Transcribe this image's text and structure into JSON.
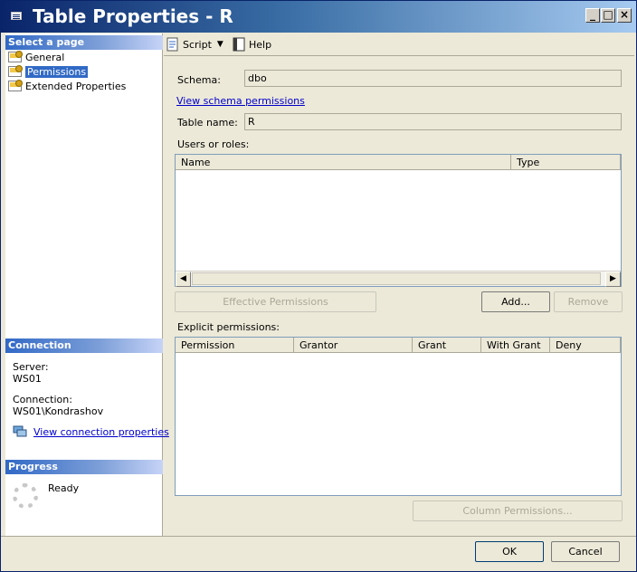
{
  "window": {
    "title": "Table Properties - R",
    "min": "_",
    "max": "□",
    "close": "×"
  },
  "left": {
    "select_page_header": "Select a page",
    "pages": [
      {
        "label": "General",
        "selected": false
      },
      {
        "label": "Permissions",
        "selected": true
      },
      {
        "label": "Extended Properties",
        "selected": false
      }
    ],
    "connection_header": "Connection",
    "server_label": "Server:",
    "server_value": "WS01",
    "connection_label": "Connection:",
    "connection_value": "WS01\\Kondrashov",
    "view_connection_link": "View connection properties",
    "progress_header": "Progress",
    "progress_status": "Ready"
  },
  "toolbar": {
    "script_label": "Script",
    "help_label": "Help"
  },
  "form": {
    "schema_label": "Schema:",
    "schema_value": "dbo",
    "view_schema_link": "View schema permissions",
    "table_name_label": "Table name:",
    "table_name_value": "R",
    "users_roles_label": "Users or roles:",
    "users_columns": [
      "Name",
      "Type"
    ],
    "effective_permissions_button": "Effective Permissions",
    "add_button": "Add...",
    "remove_button": "Remove",
    "explicit_permissions_label": "Explicit permissions:",
    "perm_columns": [
      "Permission",
      "Grantor",
      "Grant",
      "With Grant",
      "Deny"
    ],
    "column_permissions_button": "Column Permissions..."
  },
  "footer": {
    "ok_button": "OK",
    "cancel_button": "Cancel"
  },
  "colors": {
    "title_gradient_start": "#0a246a",
    "section_header": "#3169c6",
    "selection": "#316ac5",
    "link": "#0000cc"
  }
}
